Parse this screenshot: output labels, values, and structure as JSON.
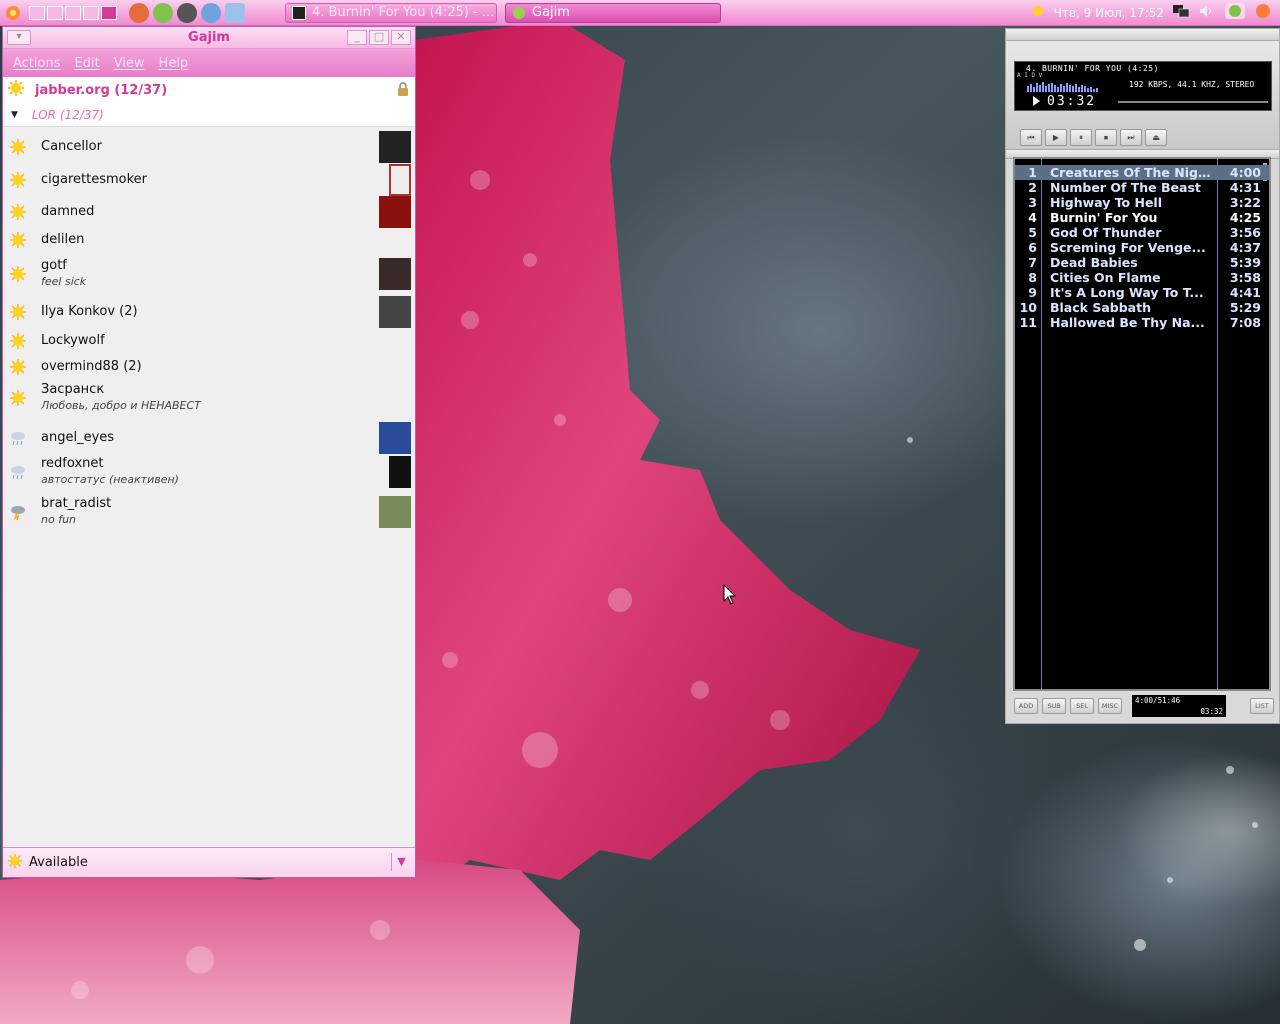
{
  "panel": {
    "tasks": [
      {
        "label": "4. Burnin' For You (4:25) - ..."
      },
      {
        "label": "Gajim"
      }
    ],
    "clock": "Чтв,  9 Июл, 17:52"
  },
  "gajim": {
    "title": "Gajim",
    "menu": [
      "Actions",
      "Edit",
      "View",
      "Help"
    ],
    "account": "jabber.org (12/37)",
    "group": "LOR (12/37)",
    "contacts": [
      {
        "name": "Cancellor",
        "status": "",
        "state": "online"
      },
      {
        "name": "cigarettesmoker",
        "status": "",
        "state": "online"
      },
      {
        "name": "damned",
        "status": "",
        "state": "online"
      },
      {
        "name": "delilen",
        "status": "",
        "state": "online"
      },
      {
        "name": "gotf",
        "status": "feel sick",
        "state": "online"
      },
      {
        "name": "Ilya Konkov (2)",
        "status": "",
        "state": "online"
      },
      {
        "name": "Lockywolf",
        "status": "",
        "state": "online"
      },
      {
        "name": "overmind88 (2)",
        "status": "",
        "state": "online"
      },
      {
        "name": "Засранск",
        "status": "Любовь, добро и НЕНАВЕСТ",
        "state": "online"
      },
      {
        "name": "angel_eyes",
        "status": "",
        "state": "away"
      },
      {
        "name": "redfoxnet",
        "status": "автостатус (неактивен)",
        "state": "away"
      },
      {
        "name": "brat_radist",
        "status": "no fun",
        "state": "dnd"
      }
    ],
    "status_selector": "Available"
  },
  "player": {
    "song_title": "4. BURNIN' FOR YOU (4:25)",
    "info": "192 KBPS, 44.1 KHZ, STEREO",
    "time": "03:32",
    "side_letters": "A I D V",
    "controls": [
      "⏮",
      "▶",
      "⏸",
      "⏹",
      "⏭",
      "⏏"
    ],
    "playlist": [
      {
        "num": "1",
        "title": "Creatures Of The Nig...",
        "dur": "4:00"
      },
      {
        "num": "2",
        "title": "Number Of The Beast",
        "dur": "4:31"
      },
      {
        "num": "3",
        "title": "Highway To Hell",
        "dur": "3:22"
      },
      {
        "num": "4",
        "title": "Burnin' For You",
        "dur": "4:25"
      },
      {
        "num": "5",
        "title": "God Of Thunder",
        "dur": "3:56"
      },
      {
        "num": "6",
        "title": "Screming For Venge...",
        "dur": "4:37"
      },
      {
        "num": "7",
        "title": "Dead Babies",
        "dur": "5:39"
      },
      {
        "num": "8",
        "title": "Cities On Flame",
        "dur": "3:58"
      },
      {
        "num": "9",
        "title": "It's A Long Way To T...",
        "dur": "4:41"
      },
      {
        "num": "10",
        "title": "Black Sabbath",
        "dur": "5:29"
      },
      {
        "num": "11",
        "title": "Hallowed Be Thy Na...",
        "dur": "7:08"
      }
    ],
    "buttons": [
      "ADD",
      "SUB",
      "SEL",
      "MISC",
      "LIST"
    ],
    "total": "4:00/51:46",
    "mini_time": "03:32"
  },
  "colors": {
    "panel_pink": "#f4a3dd",
    "accent_magenta": "#d23a9c",
    "playlist_text": "#dbe4ff",
    "playlist_selected": "#5b6f87"
  }
}
